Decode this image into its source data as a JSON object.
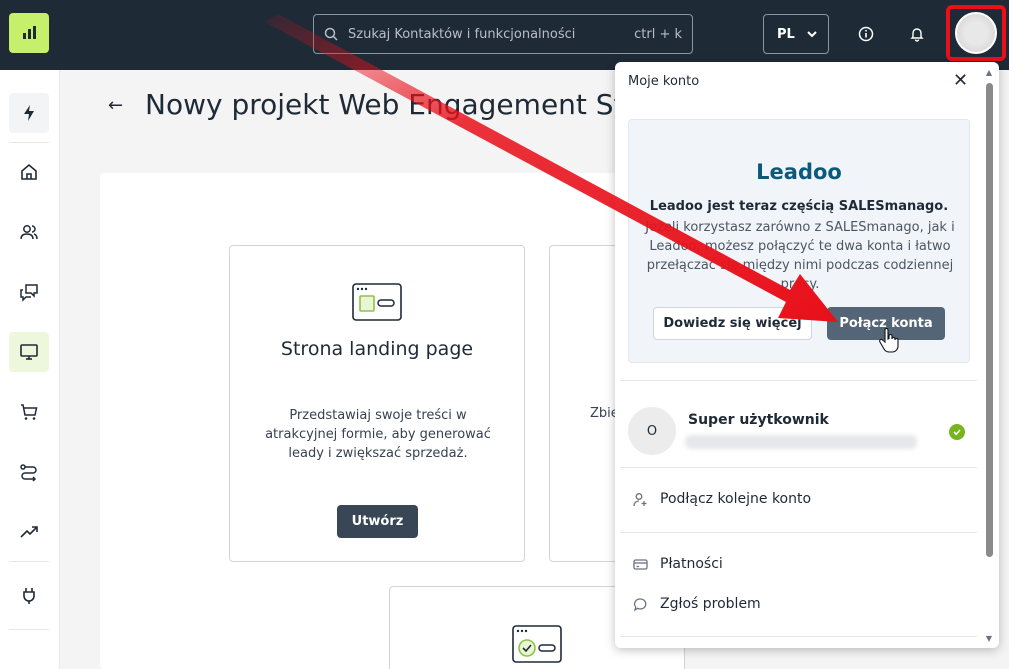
{
  "topbar": {
    "search_placeholder": "Szukaj Kontaktów i funkcjonalności",
    "search_shortcut": "ctrl + k",
    "language": "PL"
  },
  "page": {
    "title": "Nowy projekt Web Engagement Stu"
  },
  "cards": [
    {
      "title": "Strona landing page",
      "description": "Przedstawiaj swoje treści w atrakcyjnej formie, aby generować leady i zwiększać sprzedaż.",
      "button": "Utwórz"
    },
    {
      "description_fragment": "Zbie"
    }
  ],
  "account_menu": {
    "title": "Moje konto",
    "leadoo": {
      "logo": "Leadoo",
      "heading": "Leadoo jest teraz częścią SALESmanago.",
      "text": "Jeżeli korzystasz zarówno z SALESmanago, jak i Leadoo, możesz połączyć te dwa konta i łatwo przełączać się między nimi podczas codziennej pracy.",
      "learn_more": "Dowiedz się więcej",
      "connect": "Połącz konta"
    },
    "user": {
      "initial": "O",
      "name": "Super użytkownik"
    },
    "items": [
      {
        "label": "Podłącz kolejne konto",
        "icon": "add-user-icon"
      },
      {
        "label": "Płatności",
        "icon": "credit-card-icon"
      },
      {
        "label": "Zgłoś problem",
        "icon": "chat-bubble-icon"
      }
    ]
  },
  "colors": {
    "topbar": "#1f2a37",
    "accent": "#c6ef6c",
    "highlight": "#e8101a",
    "primary_button": "#394656"
  }
}
